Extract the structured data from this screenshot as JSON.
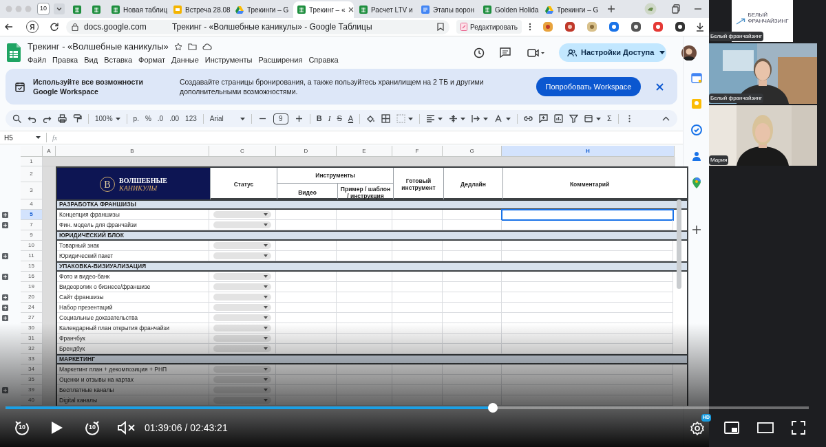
{
  "browser": {
    "tab_count": "10",
    "tabs": [
      {
        "kind": "sheets",
        "selected": false
      },
      {
        "kind": "sheets",
        "selected": false
      },
      {
        "kind": "sheets",
        "label": "Новая таблиц",
        "selected": false
      },
      {
        "kind": "slides",
        "label": "Встреча 28.08",
        "selected": false
      },
      {
        "kind": "drive",
        "label": "Трекинги – G",
        "selected": false
      },
      {
        "kind": "sheets",
        "label": "Трекинг – «",
        "selected": true
      },
      {
        "kind": "sheets",
        "label": "Расчет LTV и",
        "selected": false
      },
      {
        "kind": "docs",
        "label": "Этапы ворон",
        "selected": false
      },
      {
        "kind": "sheets",
        "label": "Golden Holida",
        "selected": false
      },
      {
        "kind": "drive",
        "label": "Трекинги – G",
        "selected": false
      }
    ],
    "browser_logo": "Я",
    "url": "docs.google.com",
    "page_title": "Трекинг - «Волшебные каникулы» - Google Таблицы",
    "edit_button": "Редактировать"
  },
  "sheets": {
    "title": "Трекинг - «Волшебные каникулы»",
    "menu": [
      "Файл",
      "Правка",
      "Вид",
      "Вставка",
      "Формат",
      "Данные",
      "Инструменты",
      "Расширения",
      "Справка"
    ],
    "share_button": "Настройки Доступа",
    "banner": {
      "title": "Используйте все возможности Google Workspace",
      "text": "Создавайте страницы бронирования, а также пользуйтесь хранилищем на 2 ТБ и другими дополнительными возможностями.",
      "button": "Попробовать Workspace"
    },
    "toolbar": {
      "zoom": "100%",
      "currency": "р.",
      "percent": "%",
      "decrease_decimals": ".0",
      "increase_decimals": ".00",
      "number_format": "123",
      "font": "Arial",
      "font_size": "9",
      "bold": "B",
      "italic": "I",
      "strikethrough": "S",
      "text_color": "A",
      "functions": "Σ"
    },
    "cell_ref": "H5",
    "formula_label": "fx",
    "columns": [
      {
        "label": "A",
        "selected": false
      },
      {
        "label": "B",
        "selected": false
      },
      {
        "label": "C",
        "selected": false
      },
      {
        "label": "D",
        "selected": false
      },
      {
        "label": "E",
        "selected": false
      },
      {
        "label": "F",
        "selected": false
      },
      {
        "label": "G",
        "selected": false
      },
      {
        "label": "H",
        "selected": true
      }
    ],
    "header": {
      "row_numbers": [
        "1",
        "2",
        "3"
      ],
      "logo_initial": "В",
      "logo_line_1": "ВОЛШЕБНЫЕ",
      "logo_line_2": "КАНИКУЛЫ",
      "status": "Статус",
      "tools": "Инструменты",
      "video": "Видео",
      "template": "Пример / шаблон / инструкция",
      "ready": "Готовый инструмент",
      "deadline": "Дедлайн",
      "comment": "Комментарий"
    },
    "rows": [
      {
        "number": "4",
        "kind": "section",
        "label": "РАЗРАБОТКА ФРАНШИЗЫ",
        "expandable": false,
        "selected": false
      },
      {
        "number": "5",
        "kind": "task",
        "label": "Концепция франшизы",
        "expandable": true,
        "selected": true
      },
      {
        "number": "7",
        "kind": "task",
        "label": "Фин. модель для франчайзи",
        "expandable": true,
        "selected": false
      },
      {
        "number": "9",
        "kind": "section",
        "label": "ЮРИДИЧЕСКИЙ БЛОК",
        "expandable": false,
        "selected": false
      },
      {
        "number": "10",
        "kind": "task",
        "label": "Товарный знак",
        "expandable": false,
        "selected": false
      },
      {
        "number": "11",
        "kind": "task",
        "label": "Юридический пакет",
        "expandable": true,
        "selected": false
      },
      {
        "number": "15",
        "kind": "section",
        "label": "УПАКОВКА-ВИЗИУАЛИЗАЦИЯ",
        "expandable": false,
        "selected": false
      },
      {
        "number": "16",
        "kind": "task",
        "label": "Фото и видео-банк",
        "expandable": true,
        "selected": false
      },
      {
        "number": "19",
        "kind": "task",
        "label": "Видеоролик о бизнесе/франшизе",
        "expandable": false,
        "selected": false
      },
      {
        "number": "20",
        "kind": "task",
        "label": "Сайт франшизы",
        "expandable": true,
        "selected": false
      },
      {
        "number": "24",
        "kind": "task",
        "label": "Набор презентаций",
        "expandable": true,
        "selected": false
      },
      {
        "number": "27",
        "kind": "task",
        "label": "Социальные доказательства",
        "expandable": true,
        "selected": false
      },
      {
        "number": "30",
        "kind": "task",
        "label": "Календарный план открытия франчайзи",
        "expandable": false,
        "selected": false
      },
      {
        "number": "31",
        "kind": "task",
        "label": "Франчбук",
        "expandable": false,
        "selected": false
      },
      {
        "number": "32",
        "kind": "task",
        "label": "Брендбук",
        "expandable": false,
        "selected": false
      },
      {
        "number": "33",
        "kind": "section",
        "label": "МАРКЕТИНГ",
        "expandable": false,
        "selected": false
      },
      {
        "number": "34",
        "kind": "task",
        "label": "Маркетинг план + декомпозиция + РНП",
        "expandable": false,
        "selected": false
      },
      {
        "number": "35",
        "kind": "task",
        "label": "Оценки и отзывы на картах",
        "expandable": false,
        "selected": false
      },
      {
        "number": "39",
        "kind": "task",
        "label": "Бесплатные каналы",
        "expandable": true,
        "selected": false
      },
      {
        "number": "40",
        "kind": "task",
        "label": "Digital каналы",
        "expandable": false,
        "selected": false
      }
    ]
  },
  "participants": [
    {
      "kind": "logo",
      "name": "Белый франчайзинг",
      "logo_line_1": "БЕЛЫЙ",
      "logo_line_2": "ФРАНЧАЙЗИНГ"
    },
    {
      "kind": "camera",
      "name": "Белый франчайзинг"
    },
    {
      "kind": "camera",
      "name": "Мария"
    }
  ],
  "player": {
    "level": 0.607,
    "muted": true,
    "rewind_label": "10",
    "forward_label": "10",
    "time": "01:39:06 / 02:43:21",
    "quality_badge": "HD"
  }
}
